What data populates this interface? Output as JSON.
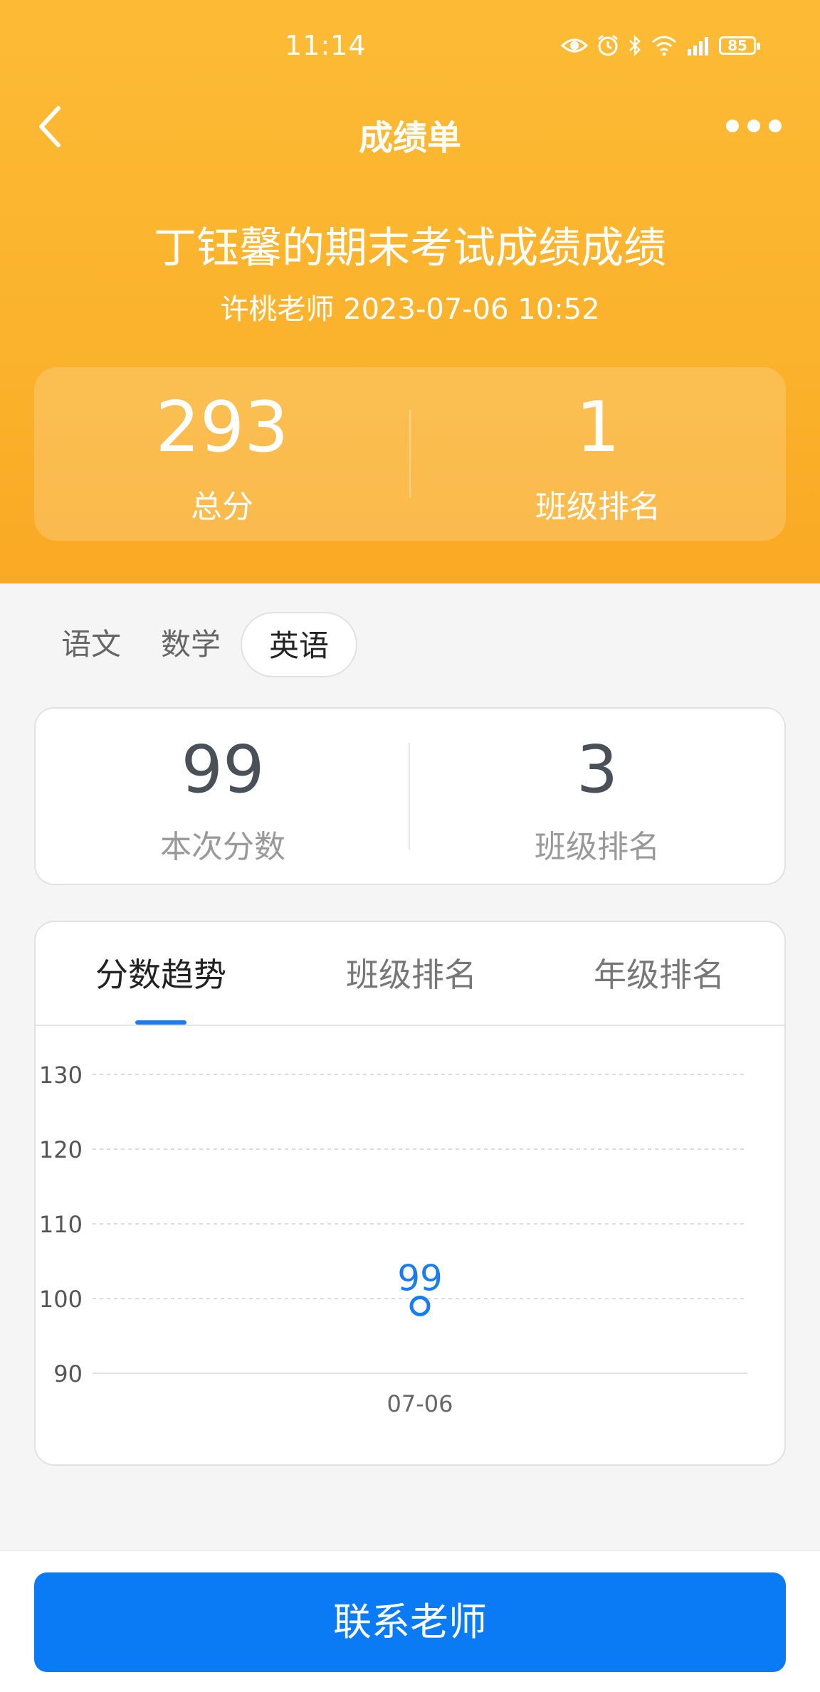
{
  "status_bar": {
    "time": "11:14",
    "battery": "85"
  },
  "nav": {
    "title": "成绩单"
  },
  "exam": {
    "title": "丁钰馨的期末考试成绩成绩",
    "subtitle": "许桃老师 2023-07-06 10:52"
  },
  "summary": {
    "total_score": "293",
    "total_label": "总分",
    "class_rank": "1",
    "class_rank_label": "班级排名"
  },
  "subjects": {
    "items": [
      "语文",
      "数学",
      "英语"
    ],
    "selected": "英语"
  },
  "subject_score": {
    "score": "99",
    "score_label": "本次分数",
    "rank": "3",
    "rank_label": "班级排名"
  },
  "trend_tabs": {
    "items": [
      "分数趋势",
      "班级排名",
      "年级排名"
    ],
    "selected": "分数趋势"
  },
  "chart_data": {
    "type": "line",
    "x": [
      "07-06"
    ],
    "series": [
      {
        "values": [
          99
        ],
        "color": "#1a7cf2"
      }
    ],
    "yticks": [
      90,
      100,
      110,
      120,
      130
    ],
    "ylim": [
      90,
      130
    ],
    "data_labels": [
      "99"
    ],
    "grid": true,
    "title": "",
    "xlabel": "",
    "ylabel": ""
  },
  "bottom": {
    "contact_label": "联系老师"
  },
  "colors": {
    "header": "#fbb22c",
    "primary": "#0a7bf5",
    "accent": "#1a7cf2"
  }
}
